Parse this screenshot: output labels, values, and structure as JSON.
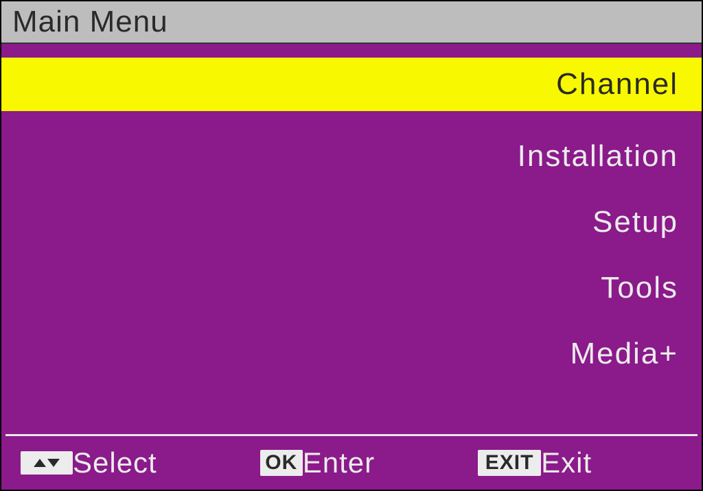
{
  "header": {
    "title": "Main Menu"
  },
  "menu": {
    "items": [
      {
        "label": "Channel",
        "selected": true
      },
      {
        "label": "Installation",
        "selected": false
      },
      {
        "label": "Setup",
        "selected": false
      },
      {
        "label": "Tools",
        "selected": false
      },
      {
        "label": "Media+",
        "selected": false
      }
    ]
  },
  "footer": {
    "select": {
      "icon": "arrows",
      "label": "Select"
    },
    "enter": {
      "icon_text": "OK",
      "label": "Enter"
    },
    "exit": {
      "icon_text": "EXIT",
      "label": "Exit"
    }
  }
}
